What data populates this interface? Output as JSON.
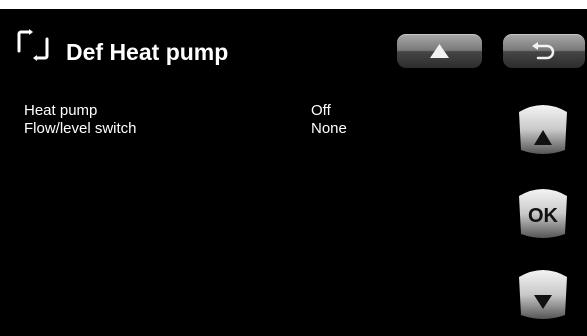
{
  "header": {
    "title": "Def Heat pump",
    "icon": "refresh-arrows-icon",
    "home_icon": "home-icon",
    "back_icon": "back-arrow-icon"
  },
  "settings": [
    {
      "label": "Heat pump",
      "value": "Off"
    },
    {
      "label": "Flow/level switch",
      "value": "None"
    }
  ],
  "nav": {
    "up_icon": "triangle-up-icon",
    "ok_label": "OK",
    "down_icon": "triangle-down-icon"
  },
  "colors": {
    "background": "#000000",
    "text": "#ffffff",
    "button_light": "#a8a8a8",
    "button_dark": "#2c2c2c"
  }
}
